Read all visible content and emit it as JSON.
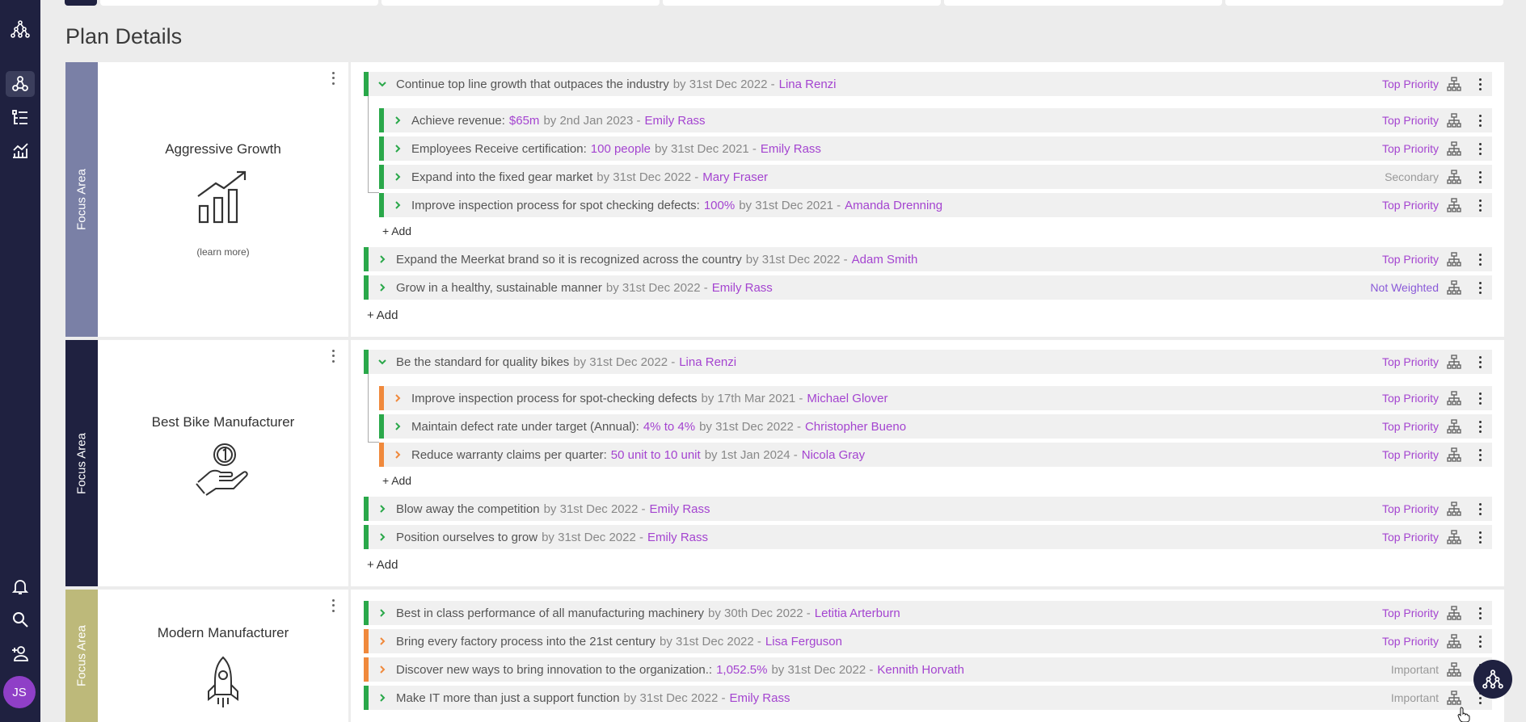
{
  "page": {
    "title": "Plan Details"
  },
  "sidebar": {
    "items": [
      {
        "icon": "org-chart-icon"
      },
      {
        "icon": "strategy-map-icon"
      },
      {
        "icon": "list-tree-icon"
      },
      {
        "icon": "chart-icon"
      },
      {
        "icon": "bell-icon"
      },
      {
        "icon": "search-icon"
      },
      {
        "icon": "add-user-icon"
      }
    ],
    "avatar_initials": "JS"
  },
  "focus_areas": [
    {
      "strip_label": "Focus Area",
      "strip_color": "#7a80a6",
      "name": "Aggressive Growth",
      "icon": "bar-chart-growth-icon",
      "learn_more": "(learn more)",
      "goals": [
        {
          "text": "Continue top line growth that outpaces the industry",
          "value": "",
          "date": "by 31st Dec 2022 -",
          "owner": "Lina Renzi",
          "priority": "Top Priority",
          "status_color": "#2aa84a",
          "expanded": true,
          "children": [
            {
              "text": "Achieve revenue:",
              "value": "$65m",
              "date": "by 2nd Jan 2023 -",
              "owner": "Emily Rass",
              "priority": "Top Priority"
            },
            {
              "text": "Employees Receive certification:",
              "value": "100 people",
              "date": "by 31st Dec 2021 -",
              "owner": "Emily Rass",
              "priority": "Top Priority"
            },
            {
              "text": "Expand into the fixed gear market",
              "value": "",
              "date": "by 31st Dec 2022 -",
              "owner": "Mary Fraser",
              "priority": "Secondary"
            },
            {
              "text": "Improve inspection process for spot checking defects:",
              "value": "100%",
              "date": "by 31st Dec 2021 -",
              "owner": "Amanda Drenning",
              "priority": "Top Priority"
            }
          ]
        },
        {
          "text": "Expand the Meerkat brand so it is recognized across the country",
          "value": "",
          "date": "by 31st Dec 2022 -",
          "owner": "Adam Smith",
          "priority": "Top Priority"
        },
        {
          "text": "Grow in a healthy, sustainable manner",
          "value": "",
          "date": "by 31st Dec 2022 -",
          "owner": "Emily Rass",
          "priority": "Not Weighted"
        }
      ]
    },
    {
      "strip_label": "Focus Area",
      "strip_color": "#1f2140",
      "name": "Best Bike Manufacturer",
      "icon": "hand-medal-icon",
      "goals": [
        {
          "text": "Be the standard for quality bikes",
          "value": "",
          "date": "by 31st Dec 2022 -",
          "owner": "Lina Renzi",
          "priority": "Top Priority",
          "expanded": true,
          "children": [
            {
              "text": "Improve inspection process for spot-checking defects",
              "value": "",
              "date": "by 17th Mar 2021 -",
              "owner": "Michael Glover",
              "priority": "Top Priority",
              "status": "orange"
            },
            {
              "text": "Maintain defect rate under target (Annual):",
              "value": "4% to 4%",
              "date": "by 31st Dec 2022 -",
              "owner": "Christopher Bueno",
              "priority": "Top Priority",
              "status": "green"
            },
            {
              "text": "Reduce warranty claims per quarter:",
              "value": "50 unit to 10 unit",
              "date": "by 1st Jan 2024 -",
              "owner": "Nicola Gray",
              "priority": "Top Priority",
              "status": "orange"
            }
          ]
        },
        {
          "text": "Blow away the competition",
          "value": "",
          "date": "by 31st Dec 2022 -",
          "owner": "Emily Rass",
          "priority": "Top Priority"
        },
        {
          "text": "Position ourselves to grow",
          "value": "",
          "date": "by 31st Dec 2022 -",
          "owner": "Emily Rass",
          "priority": "Top Priority"
        }
      ]
    },
    {
      "strip_label": "Focus Area",
      "strip_color": "#bdb97a",
      "name": "Modern Manufacturer",
      "icon": "rocket-icon",
      "goals": [
        {
          "text": "Best in class performance of all manufacturing machinery",
          "value": "",
          "date": "by 30th Dec 2022 -",
          "owner": "Letitia Arterburn",
          "priority": "Top Priority",
          "status": "green"
        },
        {
          "text": "Bring every factory process into the 21st century",
          "value": "",
          "date": "by 31st Dec 2022 -",
          "owner": "Lisa Ferguson",
          "priority": "Top Priority",
          "status": "orange"
        },
        {
          "text": "Discover new ways to bring innovation to the organization.:",
          "value": "1,052.5%",
          "date": "by 31st Dec 2022 -",
          "owner": "Kennith Horvath",
          "priority": "Important",
          "status": "orange"
        },
        {
          "text": "Make IT more than just a support function",
          "value": "",
          "date": "by 31st Dec 2022 -",
          "owner": "Emily Rass",
          "priority": "Important",
          "status": "green"
        }
      ]
    }
  ],
  "labels": {
    "add": "Add"
  },
  "colors": {
    "purple_accent": "#a444d0",
    "status_green": "#2aa84a",
    "status_orange": "#f0893c",
    "sidebar_bg": "#1f2140"
  }
}
